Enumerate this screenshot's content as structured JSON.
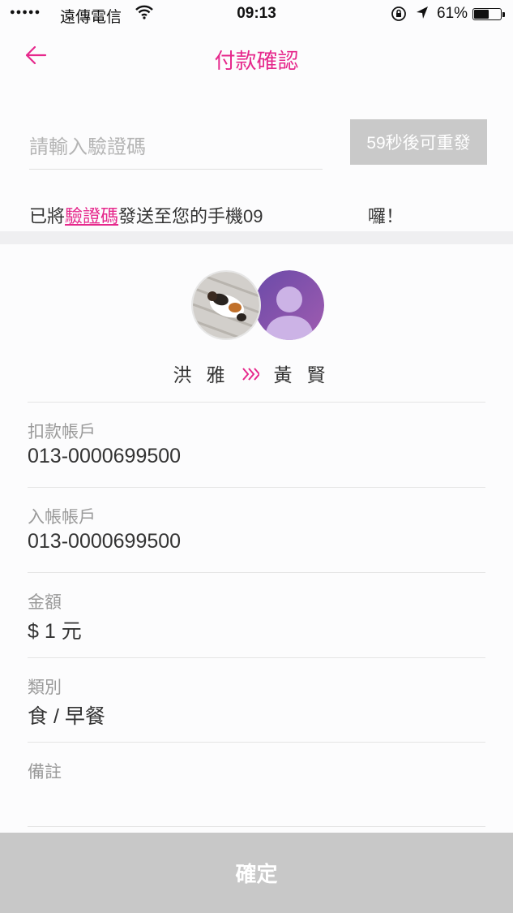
{
  "status_bar": {
    "signal": "●●●●●",
    "carrier": "遠傳電信",
    "time": "09:13",
    "battery_percent": "61%",
    "battery_level": 0.61
  },
  "nav": {
    "title": "付款確認",
    "back_icon": "arrow-left-icon"
  },
  "verification": {
    "placeholder": "請輸入驗證碼",
    "value": "",
    "resend_label": "59秒後可重發",
    "message_prefix": "已將",
    "message_link": "驗證碼",
    "message_suffix": "發送至您的手機09",
    "message_tail": "囉！"
  },
  "transfer": {
    "payer_name": "洪雅",
    "payee_name": "黃賢",
    "arrow": "»"
  },
  "fields": [
    {
      "label": "扣款帳戶",
      "value": "013-0000699500"
    },
    {
      "label": "入帳帳戶",
      "value": "013-0000699500"
    },
    {
      "label": "金額",
      "value": "$ 1 元"
    },
    {
      "label": "類別",
      "value": "食 / 早餐"
    },
    {
      "label": "備註",
      "value": ""
    }
  ],
  "confirm_label": "確定",
  "colors": {
    "accent": "#e6288c",
    "disabled_button": "#c9c9c9",
    "confirm_button": "#c8c8c8"
  }
}
